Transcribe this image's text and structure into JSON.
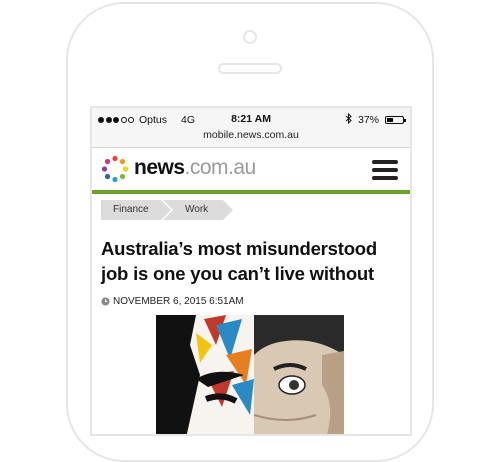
{
  "status_bar": {
    "carrier": "Optus",
    "network": "4G",
    "time": "8:21 AM",
    "battery_text": "37%",
    "battery_level": 0.37,
    "bluetooth_icon": "bluetooth-icon"
  },
  "browser": {
    "url": "mobile.news.com.au"
  },
  "site": {
    "logo_main": "news",
    "logo_domain": ".com.au",
    "brand_color": "#6ca22c",
    "menu_icon": "hamburger-menu-icon"
  },
  "breadcrumbs": [
    {
      "label": "Finance"
    },
    {
      "label": "Work"
    }
  ],
  "article": {
    "headline": "Australia’s most misunderstood job is one you can’t live without",
    "date": "NOVEMBER 6, 2015 6:51AM",
    "date_icon": "clock-icon"
  },
  "colors": {
    "text": "#111111",
    "muted": "#9a9a9a",
    "crumb_bg": "#dcdcdc",
    "statusbar_bg": "#f6f6f6"
  }
}
